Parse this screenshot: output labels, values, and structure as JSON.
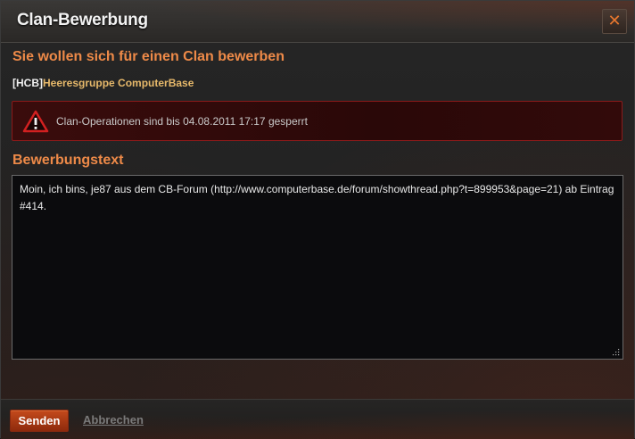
{
  "dialog": {
    "title": "Clan-Bewerbung",
    "close_icon": "close-icon"
  },
  "main": {
    "heading": "Sie wollen sich für einen Clan bewerben",
    "clan_tag": "[HCB]",
    "clan_name": "Heeresgruppe ComputerBase"
  },
  "alert": {
    "icon": "warning-icon",
    "text": "Clan-Operationen sind bis 04.08.2011 17:17 gesperrt"
  },
  "application": {
    "heading": "Bewerbungstext",
    "text": "Moin, ich bins, je87 aus dem CB-Forum (http://www.computerbase.de/forum/showthread.php?t=899953&page=21) ab Eintrag #414."
  },
  "footer": {
    "send_label": "Senden",
    "cancel_label": "Abbrechen"
  },
  "colors": {
    "accent": "#ee8a48",
    "clan_name": "#e6b86a",
    "alert_border": "#8a1a1a",
    "send_button": "#c44a1c"
  }
}
